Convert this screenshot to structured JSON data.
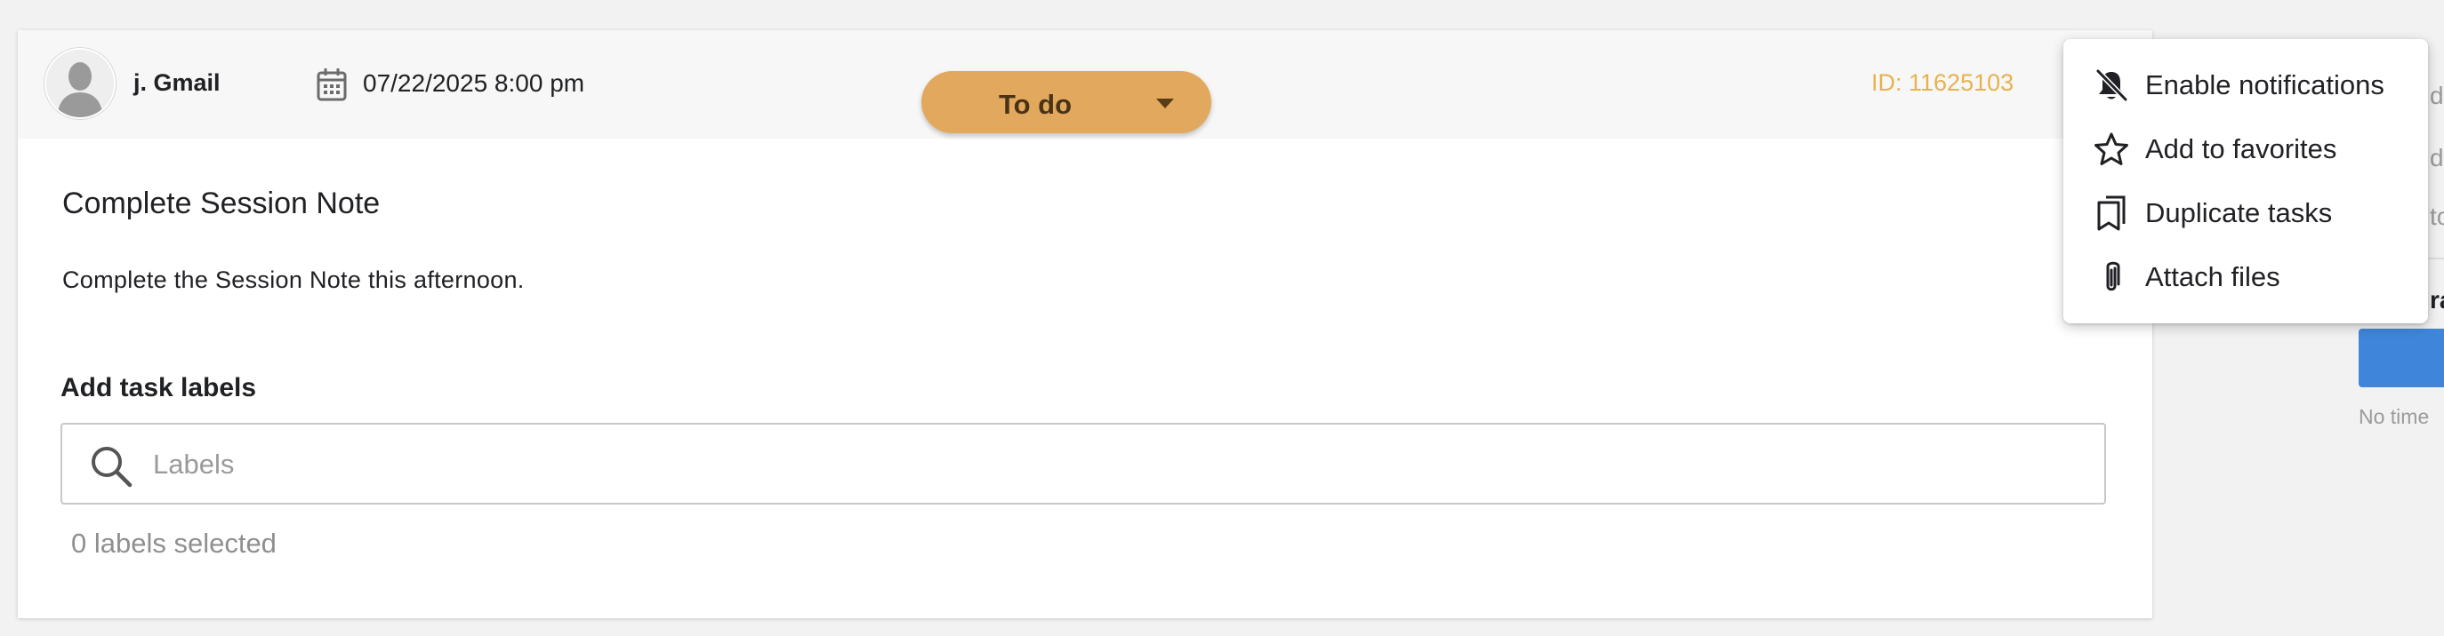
{
  "task": {
    "user_name": "j. Gmail",
    "due_date": "07/22/2025 8:00 pm",
    "id_text": "ID: 11625103",
    "status": "To do",
    "title": "Complete Session Note",
    "description": "Complete the Session Note this afternoon."
  },
  "labels": {
    "heading": "Add task labels",
    "placeholder": "Labels",
    "value": "",
    "selected_count_text": "0 labels selected"
  },
  "menu": {
    "items": [
      {
        "label": "Enable notifications",
        "icon": "bell-off-icon"
      },
      {
        "label": "Add to favorites",
        "icon": "star-outline-icon"
      },
      {
        "label": "Duplicate tasks",
        "icon": "bookmarks-icon"
      },
      {
        "label": "Attach files",
        "icon": "paperclip-icon"
      }
    ]
  },
  "right_panel": {
    "fragments": [
      "d",
      "d",
      "to",
      "ra"
    ],
    "no_time_text": "No time"
  },
  "colors": {
    "status_bg": "#e2a95e",
    "id_text": "#e8b14e",
    "accent_blue": "#3f86db"
  }
}
